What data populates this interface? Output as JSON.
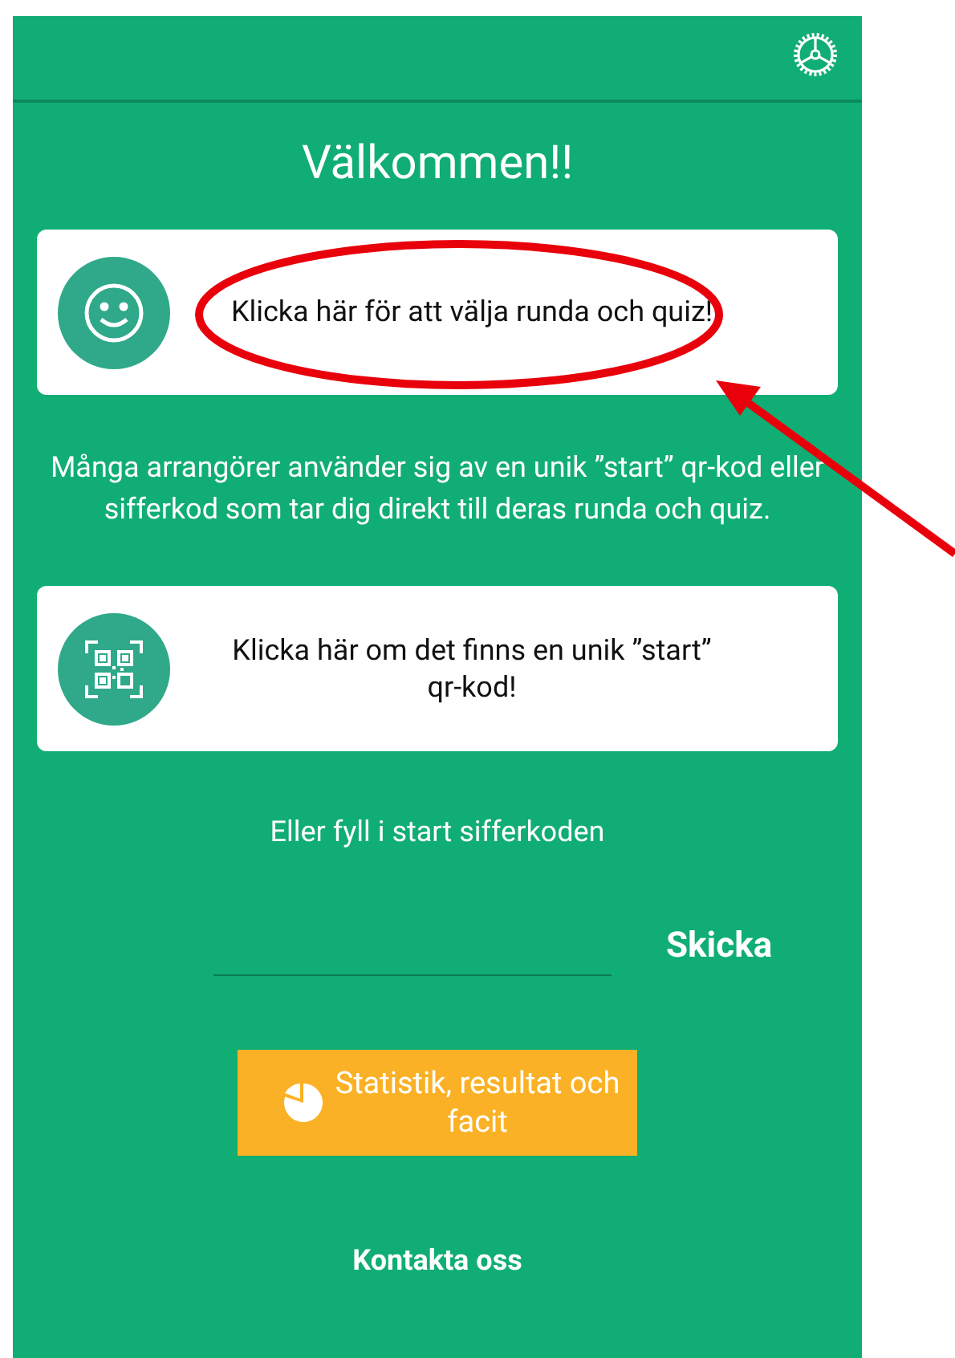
{
  "title": "Välkommen!!",
  "cards": [
    {
      "kind": "smiley",
      "label": "Klicka här för att välja runda och quiz!"
    },
    {
      "kind": "qr",
      "label": "Klicka här om det finns en unik ”start” qr-kod!"
    }
  ],
  "info": "Många arrangörer använder sig av en unik ”start” qr-kod eller sifferkod som tar dig direkt till deras runda och quiz.",
  "code_prompt": "Eller fyll i start sifferkoden",
  "submit": "Skicka",
  "stats_button": "Statistik, resultat och facit",
  "contact": "Kontakta oss"
}
